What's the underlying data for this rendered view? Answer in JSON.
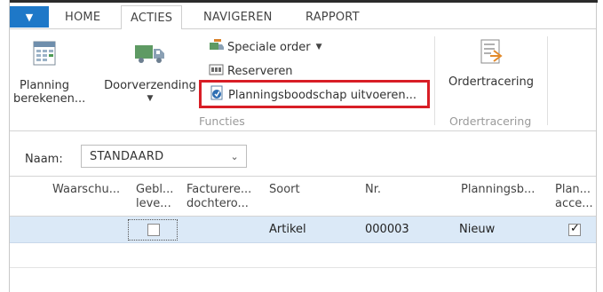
{
  "ribbon_tabs": [
    {
      "label": "HOME"
    },
    {
      "label": "ACTIES"
    },
    {
      "label": "NAVIGEREN"
    },
    {
      "label": "RAPPORT"
    }
  ],
  "ribbon": {
    "planning_line1": "Planning",
    "planning_line2": "berekenen...",
    "doorverzending": "Doorverzending",
    "speciale_order": "Speciale order",
    "reserveren": "Reserveren",
    "planningsboodschap": "Planningsboodschap uitvoeren...",
    "functies_group": "Functies",
    "ordertracering": "Ordertracering",
    "ordertracering_group": "Ordertracering",
    "accent_color": "#d81e26"
  },
  "filter": {
    "label": "Naam:",
    "value": "STANDAARD"
  },
  "grid": {
    "headers": {
      "waarschuwing": "Waarschu...",
      "geblokkeerd_l1": "Gebl...",
      "geblokkeerd_l2": "leve...",
      "factureren_l1": "Facturere...",
      "factureren_l2": "dochtero...",
      "soort": "Soort",
      "nr": "Nr.",
      "planningsb": "Planningsb...",
      "plan_l1": "Plan...",
      "plan_l2": "acce..."
    },
    "rows": [
      {
        "soort": "Artikel",
        "nr": "000003",
        "planningsb": "Nieuw",
        "geblokkeerd": false,
        "plan_accepteren": true
      }
    ]
  }
}
